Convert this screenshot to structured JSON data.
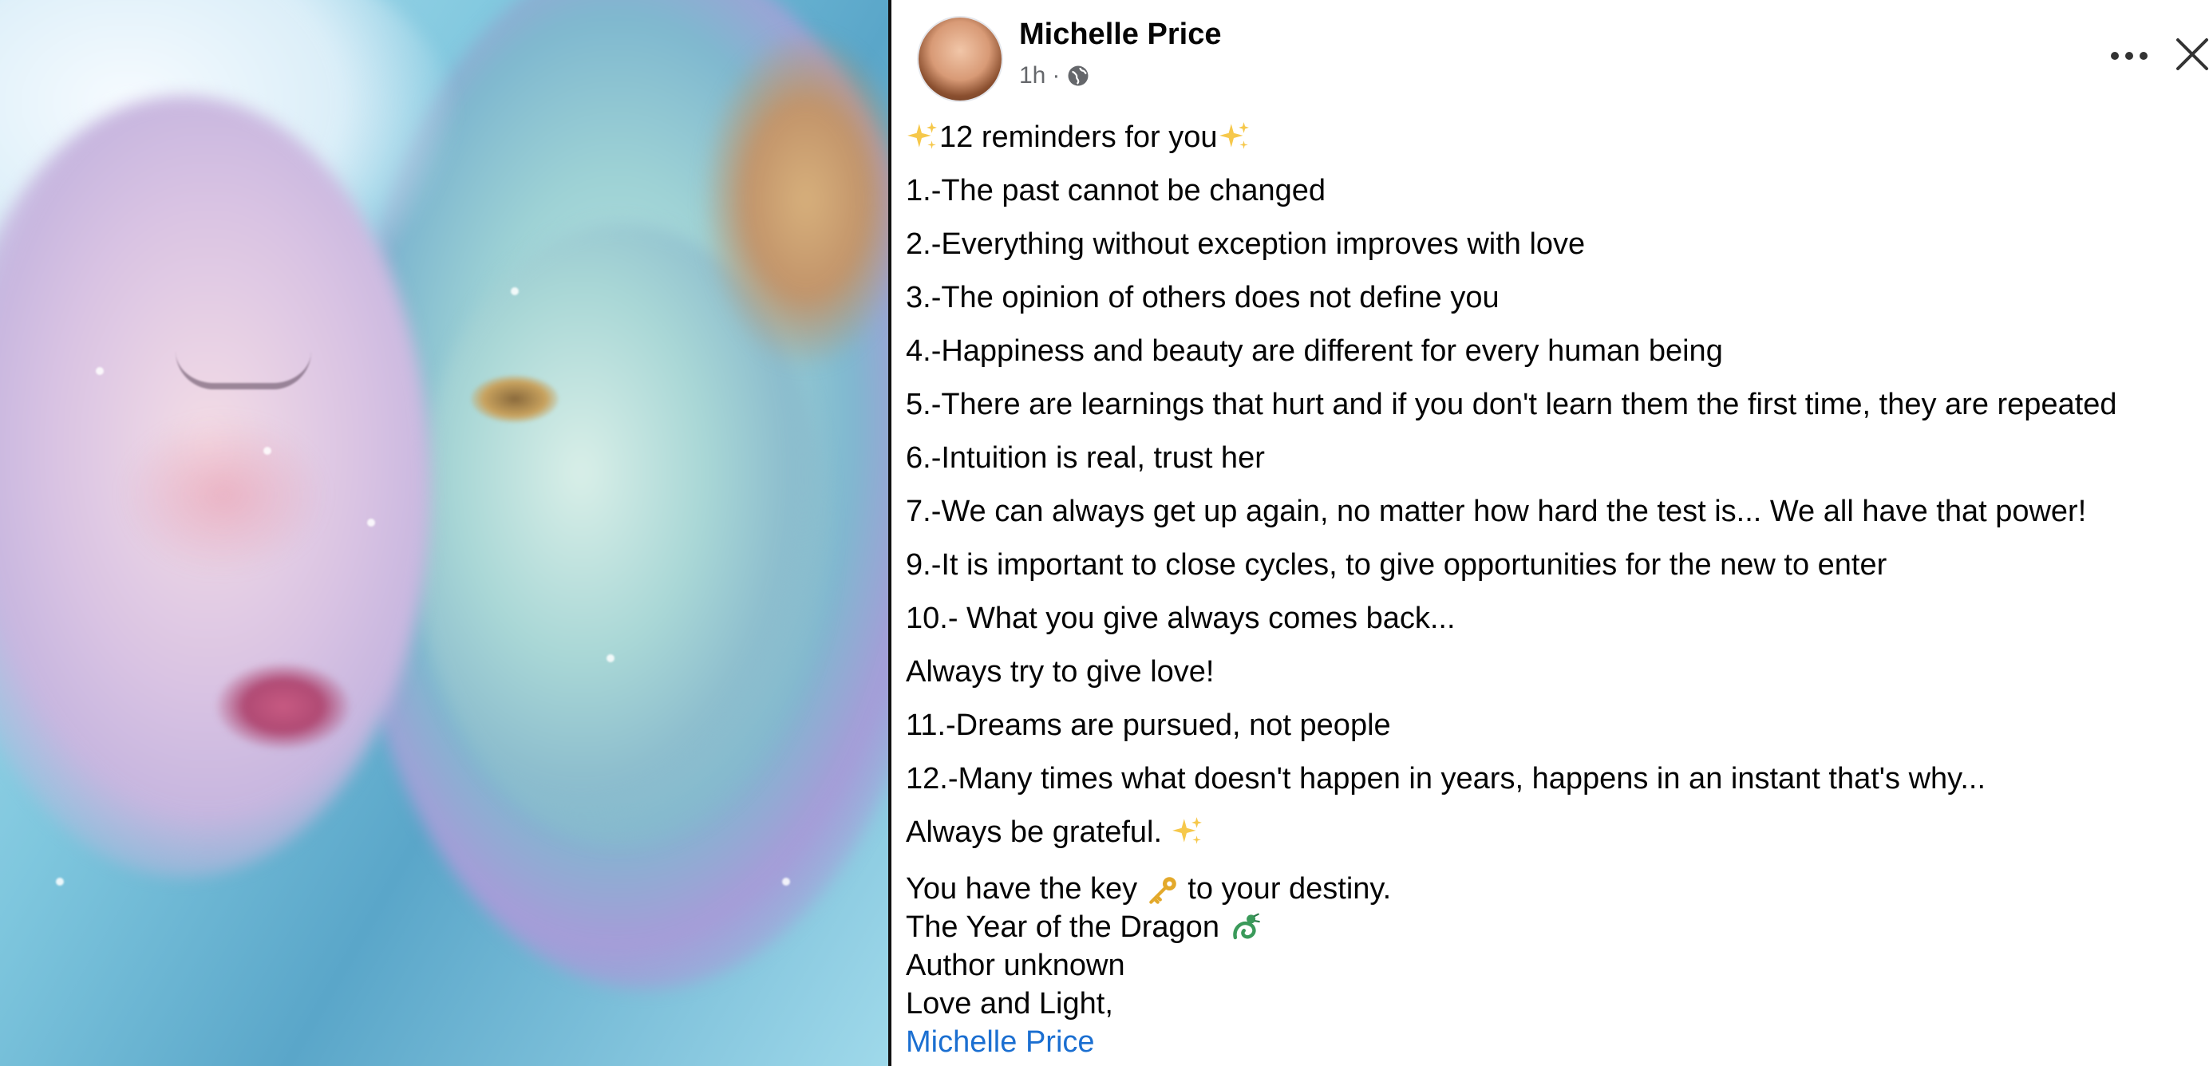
{
  "post": {
    "author": "Michelle Price",
    "time": "1h",
    "separator": "·",
    "privacy_icon": "globe-icon",
    "heading": "12 reminders for you",
    "items": [
      "1.-The past cannot be changed",
      "2.-Everything without exception improves with love",
      "3.-The opinion of others does not define you",
      "4.-Happiness and beauty are different for every human being",
      "5.-There are learnings that hurt and if you don't learn them the first time, they are repeated",
      "6.-Intuition is real, trust her",
      "7.-We can always get up again, no matter how hard the test is... We all have that power!",
      "9.-It is important to close cycles, to give opportunities for the new to enter",
      "10.- What you give always comes back...",
      "Always try to give love!",
      "11.-Dreams are pursued, not people",
      "12.-Many times what doesn't happen in years, happens in an instant that's why...",
      "Always be grateful."
    ],
    "closing": {
      "key_before": "You have the key",
      "key_after": "to your destiny.",
      "dragon_line": "The Year of the Dragon",
      "author_note": "Author unknown",
      "signoff": "Love and Light,",
      "signature_link": "Michelle Price"
    }
  },
  "icons": {
    "sparkle": "sparkle-icon",
    "key": "key-icon",
    "dragon": "dragon-icon",
    "more": "more-options-icon",
    "close": "close-icon"
  },
  "colors": {
    "link": "#1b6fd1",
    "meta_text": "#65676b",
    "primary_text": "#050505",
    "sparkle": "#f6c84b"
  }
}
